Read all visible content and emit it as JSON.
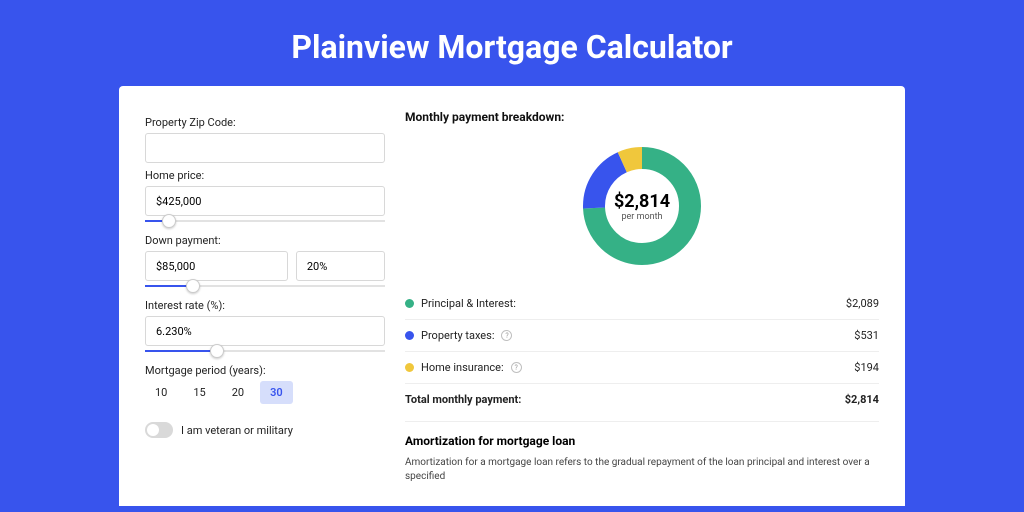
{
  "title": "Plainview Mortgage Calculator",
  "form": {
    "zip": {
      "label": "Property Zip Code:",
      "value": ""
    },
    "price": {
      "label": "Home price:",
      "value": "$425,000",
      "slider_pct": 10
    },
    "down": {
      "label": "Down payment:",
      "value": "$85,000",
      "pct": "20%",
      "slider_pct": 20
    },
    "rate": {
      "label": "Interest rate (%):",
      "value": "6.230%",
      "slider_pct": 30
    },
    "period": {
      "label": "Mortgage period (years):",
      "options": [
        "10",
        "15",
        "20",
        "30"
      ],
      "active": "30"
    },
    "veteran": {
      "label": "I am veteran or military",
      "on": false
    }
  },
  "breakdown": {
    "title": "Monthly payment breakdown:",
    "total_value": "$2,814",
    "total_sub": "per month",
    "items": [
      {
        "label": "Principal & Interest:",
        "value": "$2,089",
        "color": "#35b186",
        "pct": 74.2,
        "info": false
      },
      {
        "label": "Property taxes:",
        "value": "$531",
        "color": "#3854ed",
        "pct": 18.9,
        "info": true
      },
      {
        "label": "Home insurance:",
        "value": "$194",
        "color": "#f0c73c",
        "pct": 6.9,
        "info": true
      }
    ],
    "total_row": {
      "label": "Total monthly payment:",
      "value": "$2,814"
    }
  },
  "amort": {
    "title": "Amortization for mortgage loan",
    "body": "Amortization for a mortgage loan refers to the gradual repayment of the loan principal and interest over a specified"
  },
  "chart_data": {
    "type": "pie",
    "title": "Monthly payment breakdown",
    "series": [
      {
        "name": "Principal & Interest",
        "value": 2089,
        "color": "#35b186"
      },
      {
        "name": "Property taxes",
        "value": 531,
        "color": "#3854ed"
      },
      {
        "name": "Home insurance",
        "value": 194,
        "color": "#f0c73c"
      }
    ],
    "total": 2814,
    "center_label": "$2,814 per month"
  }
}
